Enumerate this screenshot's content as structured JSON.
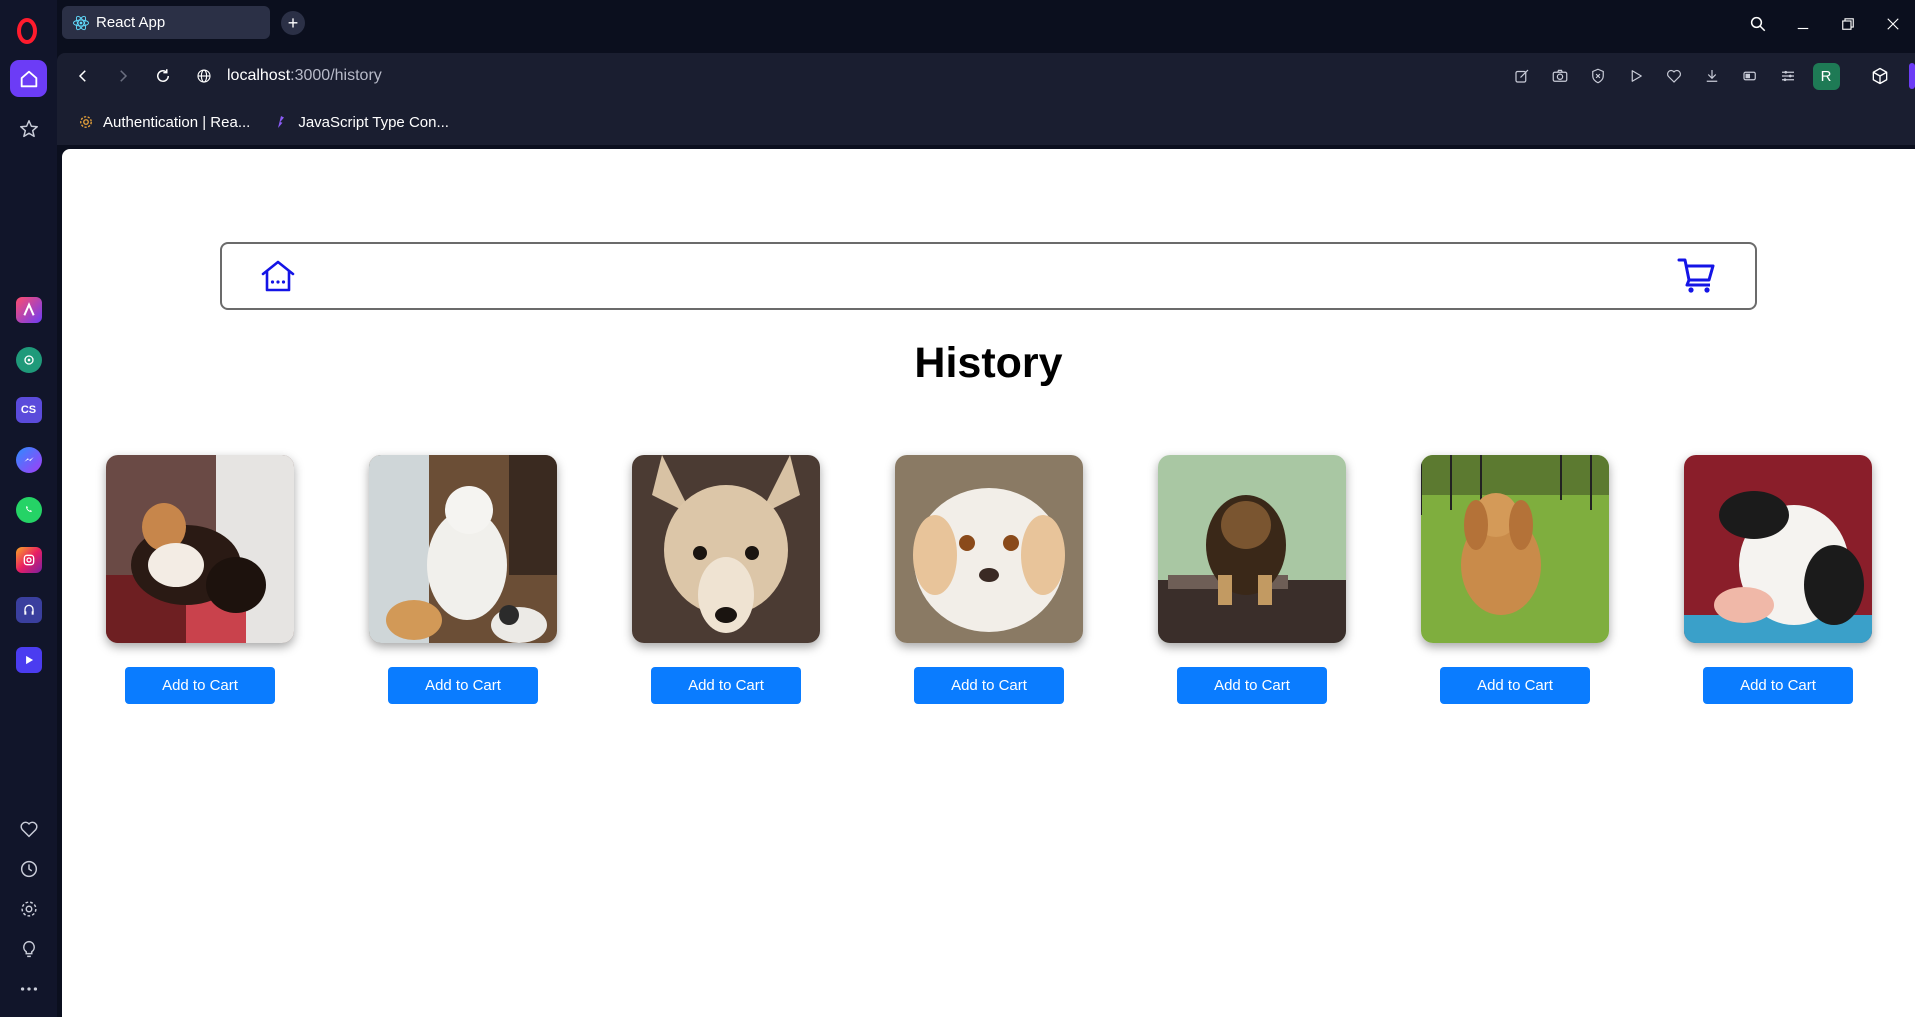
{
  "browser": {
    "tab_title": "React App",
    "url_host": "localhost",
    "url_path": ":3000/history",
    "profile_initial": "R",
    "new_tab_label": "+",
    "bookmarks": [
      {
        "label": "Authentication | Rea..."
      },
      {
        "label": "JavaScript Type Con..."
      }
    ],
    "sidebar_apps": [
      "aria-icon",
      "chatgpt-icon",
      "codesandbox-icon",
      "messenger-icon",
      "whatsapp-icon",
      "instagram-icon",
      "music-icon",
      "player-icon"
    ],
    "sidebar_app_labels": {
      "cs": "CS"
    }
  },
  "page": {
    "title": "History",
    "navbar": {
      "home_icon": "home-icon",
      "cart_icon": "cart-icon"
    },
    "products": [
      {
        "image": "sheltie-dog",
        "button": "Add to Cart"
      },
      {
        "image": "poodle-dog",
        "button": "Add to Cart"
      },
      {
        "image": "husky-puppy",
        "button": "Add to Cart"
      },
      {
        "image": "spaniel-puppy",
        "button": "Add to Cart"
      },
      {
        "image": "briard-puppy",
        "button": "Add to Cart"
      },
      {
        "image": "cocker-spaniel-dog",
        "button": "Add to Cart"
      },
      {
        "image": "terrier-puppy",
        "button": "Add to Cart"
      }
    ]
  },
  "colors": {
    "accent": "#6c3cf6",
    "button": "#0a7cff",
    "nav_icons": "#1414e6"
  }
}
